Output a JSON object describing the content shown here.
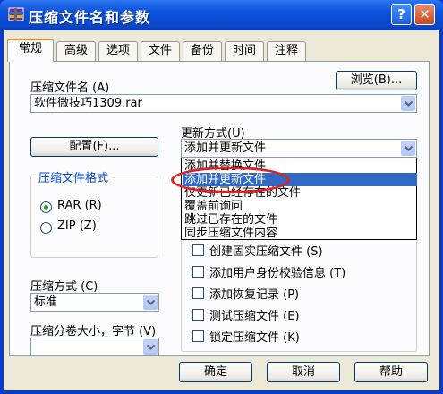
{
  "window": {
    "title": "压缩文件名和参数",
    "help_glyph": "?",
    "close_glyph": "✕"
  },
  "tabs": [
    "常规",
    "高级",
    "选项",
    "文件",
    "备份",
    "时间",
    "注释"
  ],
  "general": {
    "archive_name_label": "压缩文件名 (A)",
    "archive_name_value": "软件微技巧1309.rar",
    "browse_label": "浏览(B)...",
    "profiles_label": "配置(F)...",
    "update_mode_label": "更新方式(U)",
    "update_mode_value": "添加并更新文件",
    "update_mode_options": [
      "添加并替换文件",
      "添加并更新文件",
      "仅更新已经存在的文件",
      "覆盖前询问",
      "跳过已存在的文件",
      "同步压缩文件内容"
    ],
    "format_group_label": "压缩文件格式",
    "format_rar": "RAR (R)",
    "format_zip": "ZIP (Z)",
    "method_label": "压缩方式 (C)",
    "method_value": "标准",
    "volume_label": "压缩分卷大小，字节 (V)",
    "volume_value": "",
    "options": [
      "创建固实压缩文件 (S)",
      "添加用户身份校验信息 (T)",
      "添加恢复记录 (P)",
      "测试压缩文件 (E)",
      "锁定压缩文件 (K)"
    ]
  },
  "footer": {
    "ok_label": "确定",
    "cancel_label": "取消",
    "help_label": "帮助"
  },
  "colors": {
    "title_bar": "#0b52dd",
    "dialog_bg": "#ece9d8",
    "selection": "#316ac5",
    "annotation": "#e02020"
  }
}
